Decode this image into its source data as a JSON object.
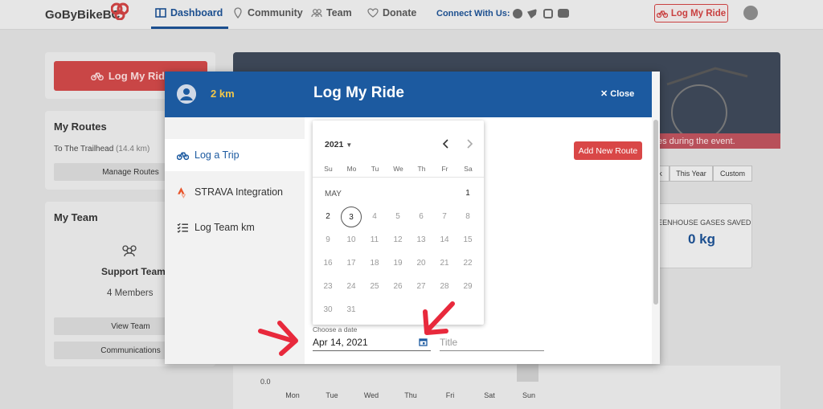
{
  "topbar": {
    "brand": "GoByBikeBC",
    "nav": [
      {
        "label": "Dashboard",
        "icon": "dashboard-icon"
      },
      {
        "label": "Community",
        "icon": "location-pin-icon"
      },
      {
        "label": "Team",
        "icon": "team-icon"
      },
      {
        "label": "Donate",
        "icon": "heart-icon"
      }
    ],
    "connect_label": "Connect With Us:",
    "social_icons": [
      "facebook-icon",
      "twitter-icon",
      "instagram-icon",
      "youtube-icon"
    ],
    "log_ride_button": "Log My Ride"
  },
  "left": {
    "log_ride_button": "Log My Ride",
    "routes_title": "My Routes",
    "route_name": "To The Trailhead",
    "route_distance": "(14.4 km)",
    "manage_routes": "Manage Routes",
    "team_title": "My Team",
    "team_name": "Support Team",
    "team_members": "4 Members",
    "view_team": "View Team",
    "communications": "Communications"
  },
  "main": {
    "hero_strip": "es during the event.",
    "segments": [
      "k",
      "This Year",
      "Custom"
    ],
    "ghg_label": "REENHOUSE GASES SAVED",
    "ghg_value": "0 kg",
    "axis_zero": "0.0",
    "days": [
      "Mon",
      "Tue",
      "Wed",
      "Thu",
      "Fri",
      "Sat",
      "Sun"
    ]
  },
  "modal": {
    "distance": "2 km",
    "title": "Log My Ride",
    "close": "Close",
    "side_items": [
      {
        "label": "Log a Trip",
        "icon": "bike-icon"
      },
      {
        "label": "STRAVA Integration",
        "icon": "strava-icon"
      },
      {
        "label": "Log Team km",
        "icon": "checklist-icon"
      }
    ],
    "add_route": "Add New Route",
    "date_label": "Choose a date",
    "date_value": "Apr 14, 2021",
    "title_placeholder": "Title"
  },
  "calendar": {
    "year": "2021",
    "weekdays": [
      "Su",
      "Mo",
      "Tu",
      "We",
      "Th",
      "Fr",
      "Sa"
    ],
    "month": "MAY",
    "days": [
      "1",
      "2",
      "3",
      "4",
      "5",
      "6",
      "7",
      "8",
      "9",
      "10",
      "11",
      "12",
      "13",
      "14",
      "15",
      "16",
      "17",
      "18",
      "19",
      "20",
      "21",
      "22",
      "23",
      "24",
      "25",
      "26",
      "27",
      "28",
      "29",
      "30",
      "31"
    ],
    "today": "3"
  },
  "colors": {
    "brand_blue": "#1c5aa0",
    "accent_red": "#d94747",
    "distance_yellow": "#f2c74a"
  }
}
